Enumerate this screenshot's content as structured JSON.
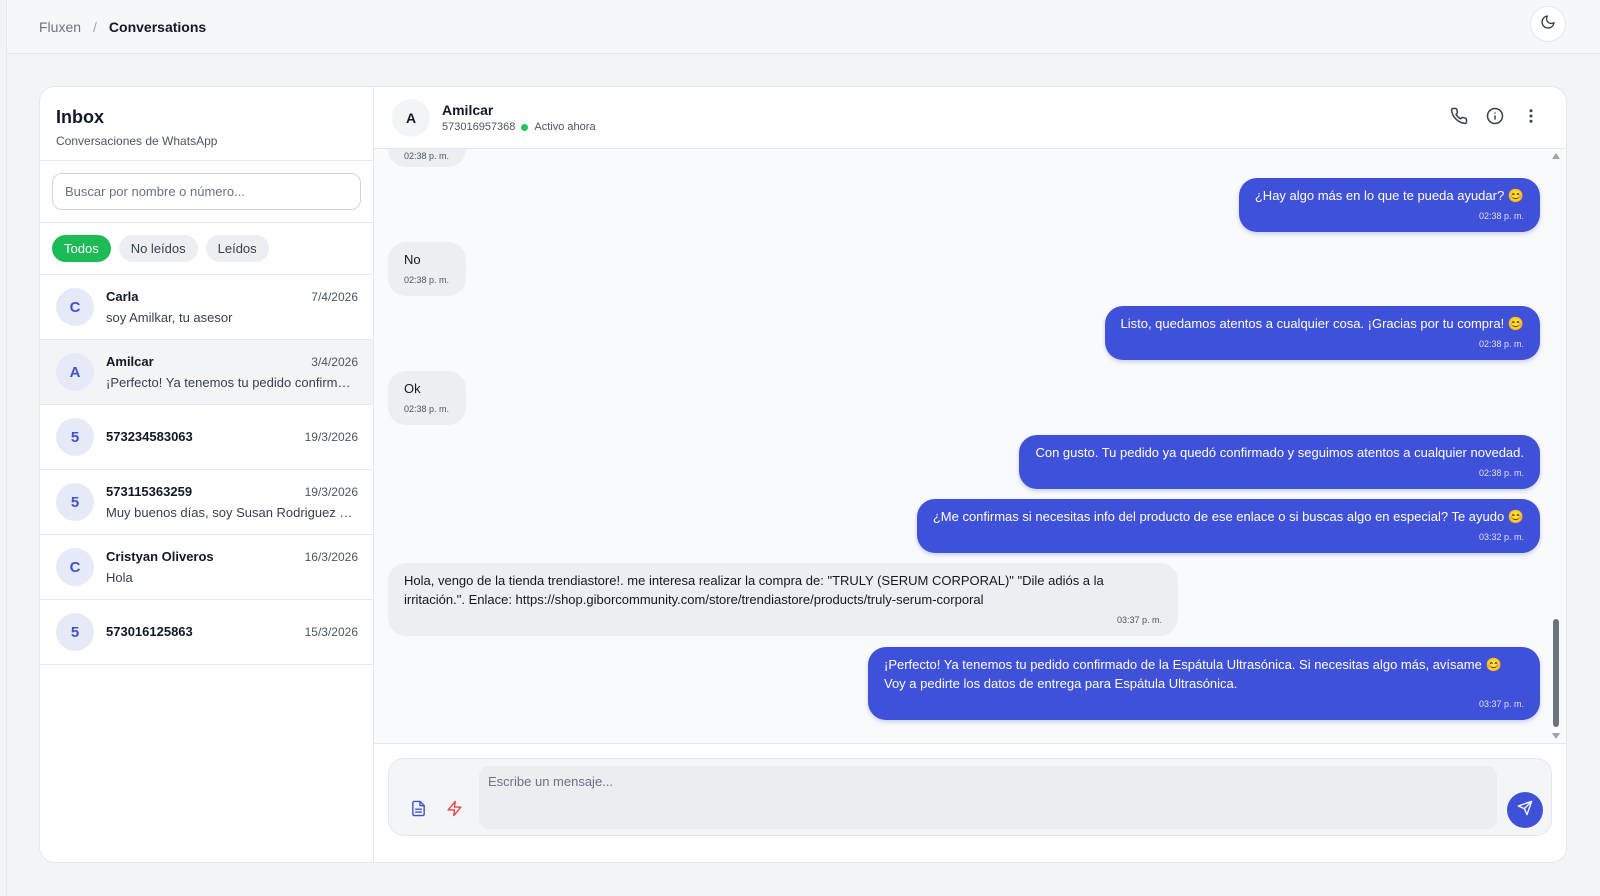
{
  "breadcrumb": {
    "root": "Fluxen",
    "separator": "/",
    "current": "Conversations"
  },
  "icons": {
    "theme": "moon-icon",
    "phone": "phone-icon",
    "info": "info-icon",
    "more": "more-vertical-icon",
    "attach": "document-icon",
    "quick": "lightning-icon",
    "send": "send-icon"
  },
  "colors": {
    "accent": "#3f51d8",
    "active_filter": "#1dbb55",
    "online": "#22c55e",
    "quick_icon": "#ef4444"
  },
  "sidebar": {
    "title": "Inbox",
    "subtitle": "Conversaciones de WhatsApp",
    "search_placeholder": "Buscar por nombre o número...",
    "filters": [
      {
        "label": "Todos",
        "active": true
      },
      {
        "label": "No leídos",
        "active": false
      },
      {
        "label": "Leídos",
        "active": false
      }
    ],
    "conversations": [
      {
        "initial": "C",
        "name": "Carla",
        "date": "7/4/2026",
        "preview": "soy Amilkar, tu asesor"
      },
      {
        "initial": "A",
        "name": "Amilcar",
        "date": "3/4/2026",
        "preview": "¡Perfecto! Ya tenemos tu pedido confirmado de la Espátula Ultrasónica.",
        "selected": true
      },
      {
        "initial": "5",
        "name": "573234583063",
        "date": "19/3/2026",
        "preview": ""
      },
      {
        "initial": "5",
        "name": "573115363259",
        "date": "19/3/2026",
        "preview": "Muy buenos días, soy Susan Rodriguez de la tienda"
      },
      {
        "initial": "C",
        "name": "Cristyan Oliveros",
        "date": "16/3/2026",
        "preview": "Hola"
      },
      {
        "initial": "5",
        "name": "573016125863",
        "date": "15/3/2026",
        "preview": ""
      }
    ]
  },
  "chat": {
    "contact_initial": "A",
    "contact_name": "Amilcar",
    "contact_phone": "573016957368",
    "status": "Activo ahora",
    "messages": [
      {
        "dir": "in",
        "text": "",
        "time": "02:38 p. m."
      },
      {
        "dir": "out",
        "text": "¿Hay algo más en lo que te pueda ayudar? 😊",
        "time": "02:38 p. m."
      },
      {
        "dir": "in",
        "text": "No",
        "time": "02:38 p. m."
      },
      {
        "dir": "out",
        "text": "Listo, quedamos atentos a cualquier cosa. ¡Gracias por tu compra! 😊",
        "time": "02:38 p. m."
      },
      {
        "dir": "in",
        "text": "Ok",
        "time": "02:38 p. m."
      },
      {
        "dir": "out",
        "text": "Con gusto. Tu pedido ya quedó confirmado y seguimos atentos a cualquier novedad.",
        "time": "02:38 p. m."
      },
      {
        "dir": "out",
        "text": "¿Me confirmas si necesitas info del producto de ese enlace o si buscas algo en especial? Te ayudo 😊",
        "time": "03:32 p. m."
      },
      {
        "dir": "in",
        "text": "Hola, vengo de la tienda trendiastore!. me interesa realizar la compra de: \"TRULY (SERUM CORPORAL)\" \"Dile adiós a la irritación.\". Enlace: https://shop.giborcommunity.com/store/trendiastore/products/truly-serum-corporal",
        "time": "03:37 p. m."
      },
      {
        "dir": "out",
        "text": "¡Perfecto! Ya tenemos tu pedido confirmado de la Espátula Ultrasónica. Si necesitas algo más, avísame 😊 Voy a pedirte los datos de entrega para Espátula Ultrasónica.",
        "time": "03:37 p. m."
      }
    ],
    "composer_placeholder": "Escribe un mensaje..."
  }
}
